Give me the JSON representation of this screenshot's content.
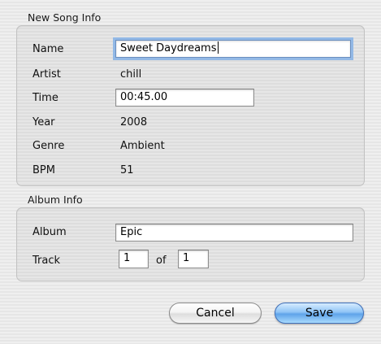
{
  "song_info": {
    "legend": "New Song Info",
    "name_label": "Name",
    "name_value": "Sweet Daydreams",
    "artist_label": "Artist",
    "artist_value": "chill",
    "time_label": "Time",
    "time_value": "00:45.00",
    "year_label": "Year",
    "year_value": "2008",
    "genre_label": "Genre",
    "genre_value": "Ambient",
    "bpm_label": "BPM",
    "bpm_value": "51"
  },
  "album_info": {
    "legend": "Album Info",
    "album_label": "Album",
    "album_value": "Epic",
    "track_label": "Track",
    "track_value": "1",
    "of_label": "of",
    "track_total_value": "1"
  },
  "buttons": {
    "cancel_label": "Cancel",
    "save_label": "Save"
  },
  "colors": {
    "focus_ring": "#93b9e6",
    "default_button": "#5fa3ea"
  }
}
